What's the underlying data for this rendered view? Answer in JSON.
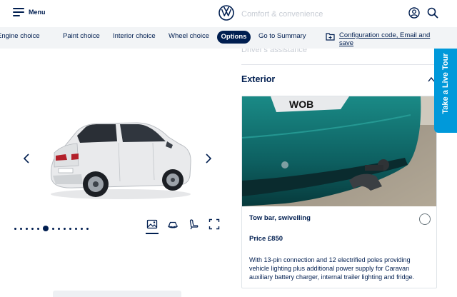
{
  "header": {
    "menu_label": "Menu",
    "ghost_heading": "Comfort & convenience"
  },
  "nav": {
    "items": [
      "Engine choice",
      "Paint choice",
      "Interior choice",
      "Wheel choice",
      "Options",
      "Go to Summary"
    ],
    "active": "Options",
    "config_link": "Configuration code, Email and save"
  },
  "gallery": {
    "dot_count": 13,
    "active_dot": 5,
    "views": [
      "exterior-image-icon",
      "car-360-icon",
      "interior-seat-icon",
      "fullscreen-icon"
    ]
  },
  "panel": {
    "ghost_section": "Driver's assistance",
    "section_title": "Exterior",
    "option": {
      "name": "Tow bar, swivelling",
      "price": "Price £850",
      "description": "With 13-pin connection and 12 electrified poles providing vehicle lighting plus additional power supply for Caravan auxiliary battery charger, internal trailer lighting and fridge."
    }
  },
  "live_tour": {
    "label": "Take a Live Tour"
  },
  "colors": {
    "brand_navy": "#001e50",
    "accent_blue": "#0099da",
    "nav_bg": "#f2f4f6"
  }
}
